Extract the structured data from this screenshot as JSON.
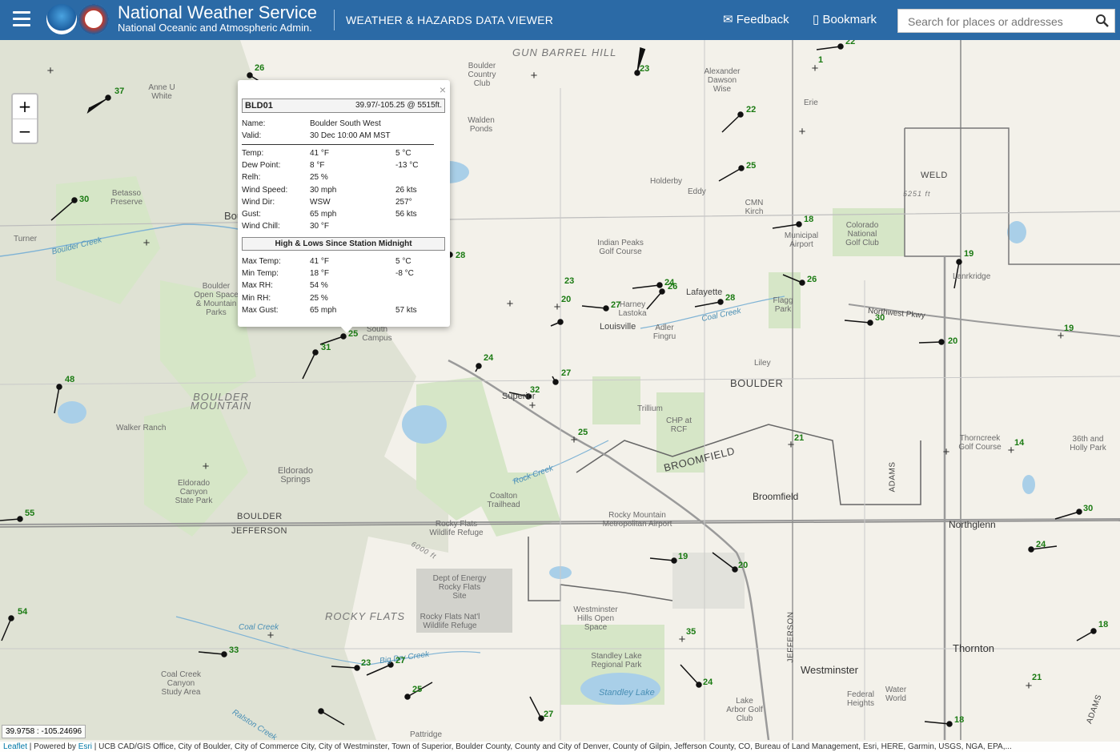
{
  "header": {
    "org_title": "National Weather Service",
    "org_subtitle": "National Oceanic and Atmospheric Admin.",
    "viewer_title": "WEATHER & HAZARDS DATA VIEWER",
    "feedback_label": "Feedback",
    "bookmark_label": "Bookmark",
    "search_placeholder": "Search for places or addresses",
    "colors": {
      "bar": "#2b6aa6",
      "text": "#ffffff"
    }
  },
  "zoom": {
    "in": "+",
    "out": "−"
  },
  "popup": {
    "close": "×",
    "station_id": "BLD01",
    "location": "39.97/-105.25 @ 5515ft.",
    "name_label": "Name:",
    "name_value": "Boulder South West",
    "valid_label": "Valid:",
    "valid_value": "30 Dec 10:00 AM MST",
    "obs": [
      {
        "label": "Temp:",
        "v1": "41 °F",
        "v2": "5 °C"
      },
      {
        "label": "Dew Point:",
        "v1": "8 °F",
        "v2": "-13 °C"
      },
      {
        "label": "Relh:",
        "v1": "25 %",
        "v2": ""
      },
      {
        "label": "Wind Speed:",
        "v1": "30 mph",
        "v2": "26 kts"
      },
      {
        "label": "Wind Dir:",
        "v1": "WSW",
        "v2": "257°"
      },
      {
        "label": "Gust:",
        "v1": "65 mph",
        "v2": "56 kts"
      },
      {
        "label": "Wind Chill:",
        "v1": "30 °F",
        "v2": ""
      }
    ],
    "section_title": "High & Lows Since Station Midnight",
    "highs_lows": [
      {
        "label": "Max Temp:",
        "v1": "41 °F",
        "v2": "5 °C"
      },
      {
        "label": "Min Temp:",
        "v1": "18 °F",
        "v2": "-8 °C"
      },
      {
        "label": "Max RH:",
        "v1": "54 %",
        "v2": ""
      },
      {
        "label": "Min RH:",
        "v1": "25 %",
        "v2": ""
      },
      {
        "label": "Max Gust:",
        "v1": "65 mph",
        "v2": "57 kts"
      }
    ]
  },
  "map": {
    "places": [
      "GUN BARREL HILL",
      "Boulder Country Club",
      "Walden Ponds",
      "Alexander Dawson Wise",
      "Erie",
      "Anne U White",
      "Betasso Preserve",
      "Turner",
      "Boulder Creek",
      "Holderby",
      "Eddy",
      "CMN Kirch",
      "Municipal Airport",
      "Colorado National Golf Club",
      "WELD",
      "Indian Peaks Golf Course",
      "Lafayette",
      "Louisville",
      "Harney Lastoka",
      "Adler Fingru",
      "Coal Creek",
      "Flagg Park",
      "Northwest Pkwy",
      "Lanrkridge",
      "BOULDER MOUNTAIN",
      "Walker Ranch",
      "Boulder Open Space & Mountain Parks",
      "Superior",
      "South Campus",
      "Liley",
      "BOULDER",
      "Trillium",
      "CHP at RCF",
      "BROOMFIELD",
      "Broomfield",
      "Thorncreek Golf Course",
      "36th and Holly Park",
      "Eldorado Springs",
      "Eldorado Canyon State Park",
      "Coalton Trailhead",
      "Rock Creek",
      "BOULDER",
      "JEFFERSON",
      "Rocky Flats Wildlife Refuge",
      "Rocky Mountain Metropolitan Airport",
      "Northglenn",
      "Dept of Energy Rocky Flats Site",
      "ROCKY FLATS",
      "Rocky Flats Nat'l Wildlife Refuge",
      "Westminster Hills Open Space",
      "ADAMS",
      "JEFFERSON",
      "Standley Lake Regional Park",
      "Standley Lake",
      "Westminster",
      "Federal Heights",
      "Water World",
      "Thornton",
      "Lake Arbor Golf Club",
      "Coal Creek Canyon Study Area",
      "Ralston Creek",
      "Big Dry Creek",
      "Pattridge",
      "ADAMS",
      "Boulder",
      "Coal Creek",
      "5251 ft",
      "6000 ft"
    ],
    "stations": [
      "26",
      "37",
      "22",
      "23",
      "22",
      "1",
      "25",
      "18",
      "19",
      "30",
      "28",
      "23",
      "20",
      "27",
      "24",
      "26",
      "28",
      "26",
      "30",
      "20",
      "19",
      "25",
      "31",
      "24",
      "27",
      "32",
      "25",
      "48",
      "21",
      "14",
      "55",
      "30",
      "19",
      "20",
      "24",
      "54",
      "33",
      "23",
      "27",
      "25",
      "35",
      "24",
      "27",
      "18",
      "21",
      "18"
    ],
    "colors": {
      "station_text": "#1a7a12",
      "map_bg": "#f3f1ea",
      "park": "#d6e6c7",
      "water": "#a9cfe8",
      "road": "#9a9a9a"
    }
  },
  "coords": "39.9758 : -105.24696",
  "attribution": {
    "leaflet": "Leaflet",
    "powered": " | Powered by ",
    "esri": "Esri",
    "text": " | UCB CAD/GIS Office, City of Boulder, City of Commerce City, City of Westminster, Town of Superior, Boulder County, County and City of Denver, County of Gilpin, Jefferson County, CO, Bureau of Land Management, Esri, HERE, Garmin, USGS, NGA, EPA,..."
  }
}
